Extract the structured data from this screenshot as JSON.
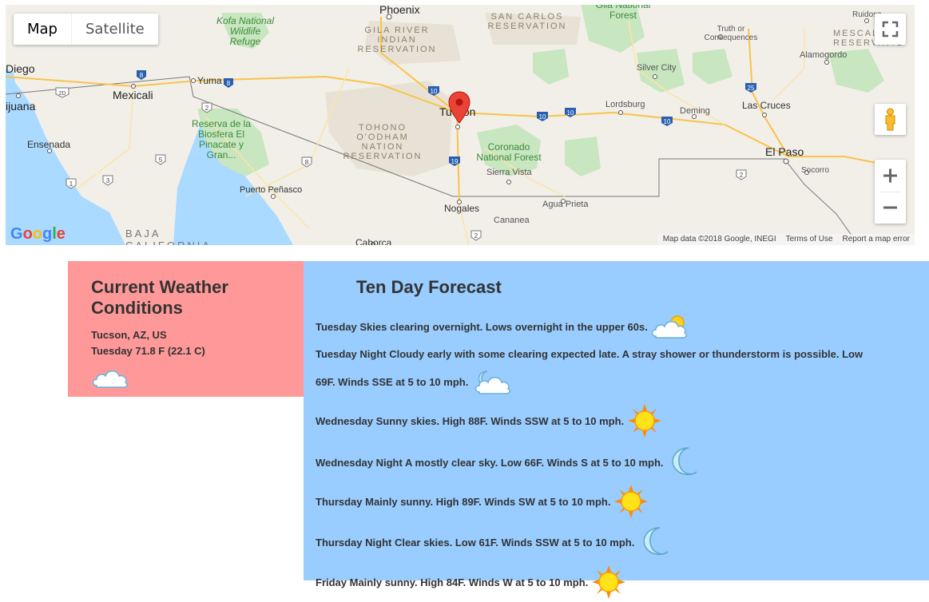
{
  "map": {
    "type_buttons": [
      "Map",
      "Satellite"
    ],
    "labels": {
      "phoenix": "Phoenix",
      "diego": "Diego",
      "tijuana": "ijuana",
      "mexicali": "Mexicali",
      "yuma": "Yuma",
      "ensenada": "Ensenada",
      "tucson": "Tucson",
      "nogales": "Nogales",
      "sierra_vista": "Sierra Vista",
      "agua_prieta": "Agua Prieta",
      "cananea": "Cananea",
      "caborca": "Caborca",
      "puerto_penasco": "Puerto Peñasco",
      "lordsburg": "Lordsburg",
      "deming": "Deming",
      "las_cruces": "Las Cruces",
      "el_paso": "El Paso",
      "socorro": "Socorro",
      "silver_city": "Silver City",
      "truth_or_consequences": "Truth or Consequences",
      "alamogordo": "Alamogordo",
      "ruidoso": "Ruidoso",
      "kofa": "Kofa National Wildlife Refuge",
      "gila_river": "GILA RIVER INDIAN RESERVATION",
      "san_carlos": "SAN CARLOS RESERVATION",
      "tohono": "TOHONO O'ODHAM NATION RESERVATION",
      "mescalero": "MESCALER RESERVATIO",
      "gila_nf": "Gila National Forest",
      "coronado": "Coronado National Forest",
      "reserva": "Reserva de la Biosfera El Pinacate y Gran...",
      "baja": "BAJA CALIFORNIA"
    },
    "shields": [
      "8",
      "8",
      "10",
      "10",
      "10",
      "10",
      "19",
      "25",
      "2D",
      "2",
      "5",
      "1",
      "3",
      "8",
      "2",
      "2"
    ],
    "attribution": [
      "Map data ©2018 Google, INEGI",
      "Terms of Use",
      "Report a map error"
    ],
    "google_logo": "Google"
  },
  "current": {
    "title": "Current Weather Conditions",
    "location": "Tucson, AZ, US",
    "observation": "Tuesday 71.8 F (22.1 C)",
    "icon": "cloud-icon"
  },
  "forecast": {
    "title": "Ten Day Forecast",
    "items": [
      {
        "text": "Tuesday Skies clearing overnight. Lows overnight in the upper 60s.",
        "icon": "partly-cloudy-icon"
      },
      {
        "text": "Tuesday Night Cloudy early with some clearing expected late. A stray shower or thunderstorm is possible. Low",
        "text2": "69F. Winds SSE at 5 to 10 mph.",
        "icon": "night-cloudy-icon"
      },
      {
        "text": "Wednesday Sunny skies. High 88F. Winds SSW at 5 to 10 mph.",
        "icon": "sun-icon"
      },
      {
        "text": "Wednesday Night A mostly clear sky. Low 66F. Winds S at 5 to 10 mph.",
        "icon": "moon-icon"
      },
      {
        "text": "Thursday Mainly sunny. High 89F. Winds SW at 5 to 10 mph.",
        "icon": "sun-icon"
      },
      {
        "text": "Thursday Night Clear skies. Low 61F. Winds SSW at 5 to 10 mph.",
        "icon": "moon-icon"
      },
      {
        "text": "Friday Mainly sunny. High 84F. Winds W at 5 to 10 mph.",
        "icon": "sun-icon"
      }
    ]
  },
  "colors": {
    "current_bg": "#ff9999",
    "forecast_bg": "#99ccff",
    "marker": "#ea4335"
  }
}
